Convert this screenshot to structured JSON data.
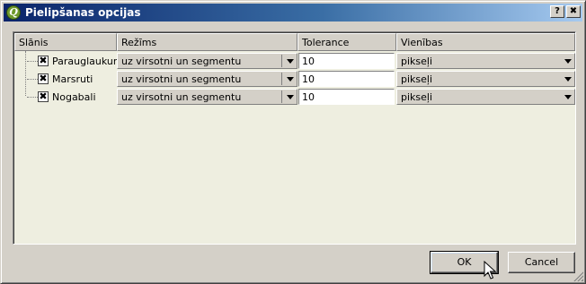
{
  "window": {
    "title": "Pielipšanas opcijas",
    "help_label": "?",
    "close_label": "✖"
  },
  "table": {
    "columns": [
      "Slānis",
      "Režīms",
      "Tolerance",
      "Vienības"
    ],
    "rows": [
      {
        "layer": "Parauglaukumi",
        "checked": true,
        "mode": "uz virsotni un segmentu",
        "tolerance": "10",
        "units": "pikseļi"
      },
      {
        "layer": "Marsruti",
        "checked": true,
        "mode": "uz virsotni un segmentu",
        "tolerance": "10",
        "units": "pikseļi"
      },
      {
        "layer": "Nogabali",
        "checked": true,
        "mode": "uz virsotni un segmentu",
        "tolerance": "10",
        "units": "pikseļi"
      }
    ]
  },
  "buttons": {
    "ok": "OK",
    "cancel": "Cancel"
  },
  "check_glyph": "✖",
  "colors": {
    "titlebar_start": "#0a246a",
    "titlebar_end": "#a6caf0",
    "table_background": "#eeeee0",
    "dialog_face": "#d4d0c8"
  }
}
